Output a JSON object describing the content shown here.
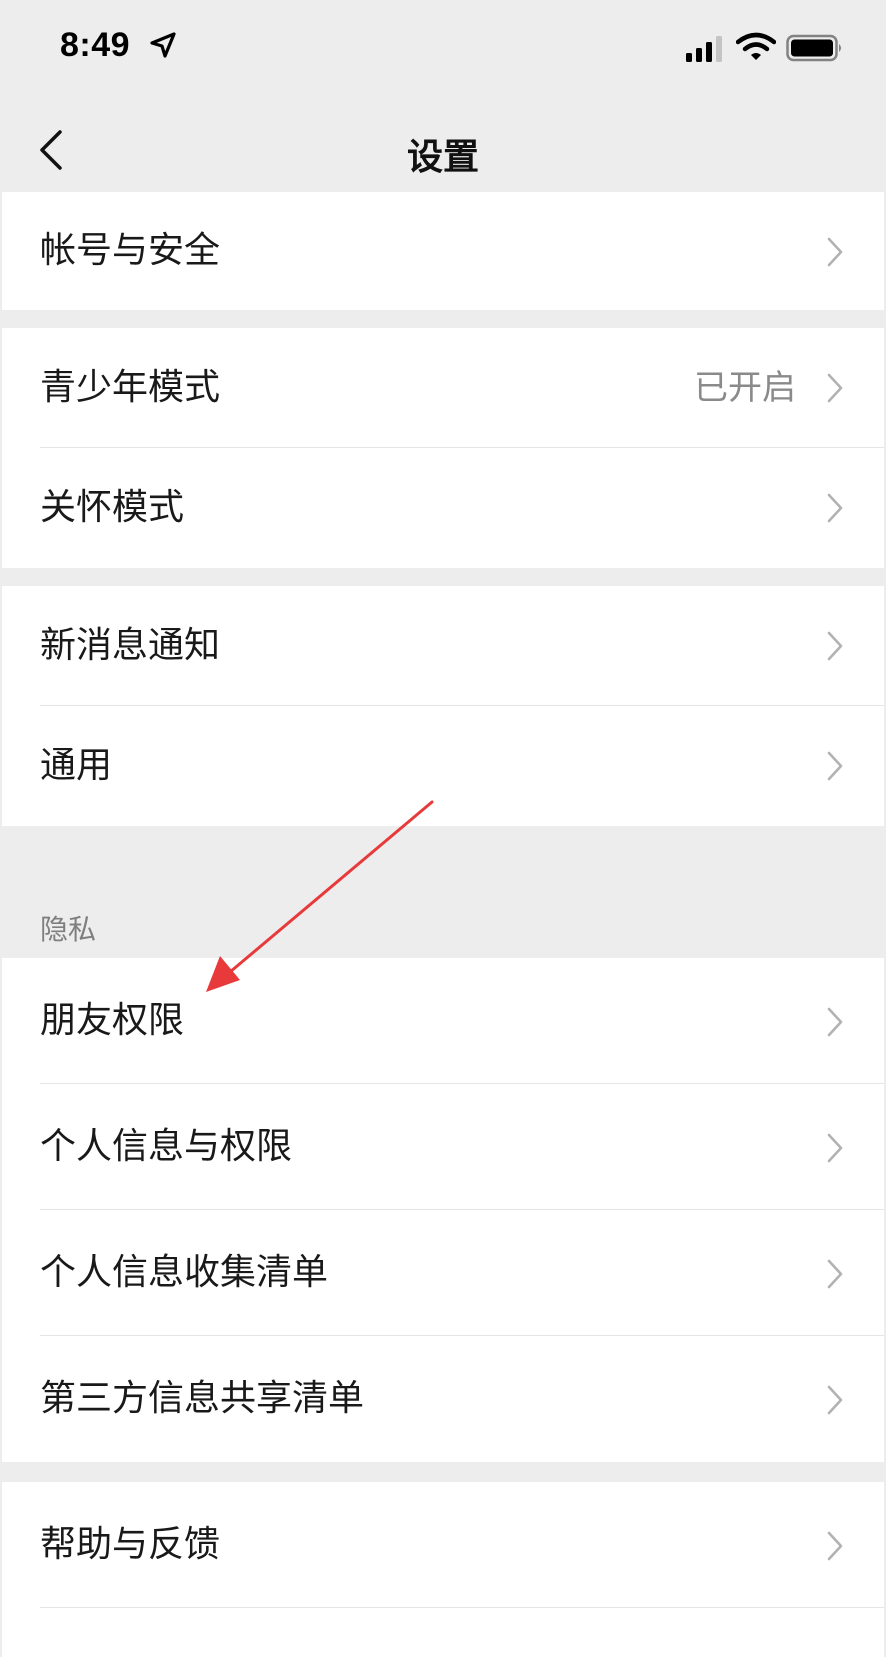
{
  "status_bar": {
    "time": "8:49"
  },
  "nav": {
    "title": "设置"
  },
  "groups": [
    {
      "items": [
        {
          "label": "帐号与安全"
        }
      ]
    },
    {
      "items": [
        {
          "label": "青少年模式",
          "value": "已开启"
        },
        {
          "label": "关怀模式"
        }
      ]
    },
    {
      "items": [
        {
          "label": "新消息通知"
        },
        {
          "label": "通用"
        }
      ]
    },
    {
      "header": "隐私",
      "items": [
        {
          "label": "朋友权限"
        },
        {
          "label": "个人信息与权限"
        },
        {
          "label": "个人信息收集清单"
        },
        {
          "label": "第三方信息共享清单"
        }
      ]
    },
    {
      "items": [
        {
          "label": "帮助与反馈"
        }
      ]
    }
  ],
  "icons": {
    "back": "chevron-left-icon",
    "chevron": "chevron-right-icon",
    "signal": "signal-icon",
    "wifi": "wifi-icon",
    "battery": "battery-icon",
    "location": "location-arrow-icon"
  },
  "colors": {
    "background": "#ededed",
    "card": "#ffffff",
    "annotation_arrow": "#e8393b"
  }
}
